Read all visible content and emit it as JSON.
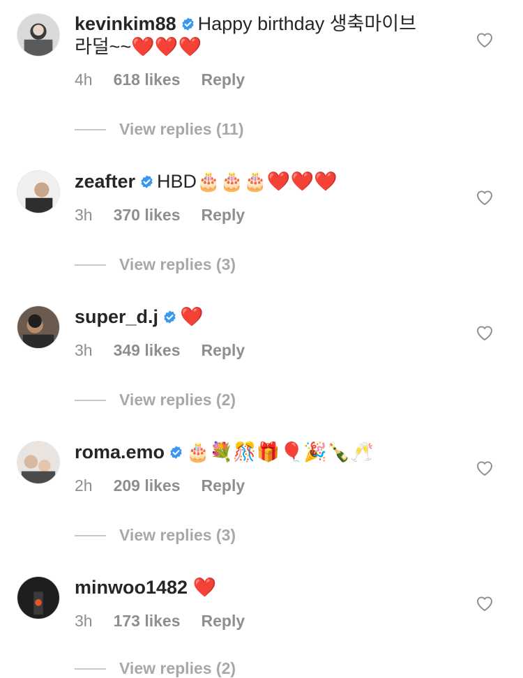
{
  "comments": [
    {
      "username": "kevinkim88",
      "verified": true,
      "text_line1": "Happy birthday 생축마이브",
      "text_line2": "라덜~~❤️❤️❤️",
      "time": "4h",
      "likes": "618 likes",
      "reply": "Reply",
      "view_replies": "View replies (11)"
    },
    {
      "username": "zeafter",
      "verified": true,
      "text_line1": "HBD🎂🎂🎂❤️❤️❤️",
      "time": "3h",
      "likes": "370 likes",
      "reply": "Reply",
      "view_replies": "View replies (3)"
    },
    {
      "username": "super_d.j",
      "verified": true,
      "text_line1": "❤️",
      "time": "3h",
      "likes": "349 likes",
      "reply": "Reply",
      "view_replies": "View replies (2)"
    },
    {
      "username": "roma.emo",
      "verified": true,
      "text_line1": "🎂💐🎊🎁🎈🎉🍾🥂",
      "time": "2h",
      "likes": "209 likes",
      "reply": "Reply",
      "view_replies": "View replies (3)"
    },
    {
      "username": "minwoo1482",
      "verified": false,
      "text_line1": "❤️",
      "time": "3h",
      "likes": "173 likes",
      "reply": "Reply",
      "view_replies": "View replies (2)"
    }
  ],
  "icons": {
    "verified": "verified-badge-icon",
    "like": "heart-outline-icon"
  },
  "colors": {
    "verified_blue": "#3897f0",
    "meta_gray": "#8e8e8e"
  }
}
